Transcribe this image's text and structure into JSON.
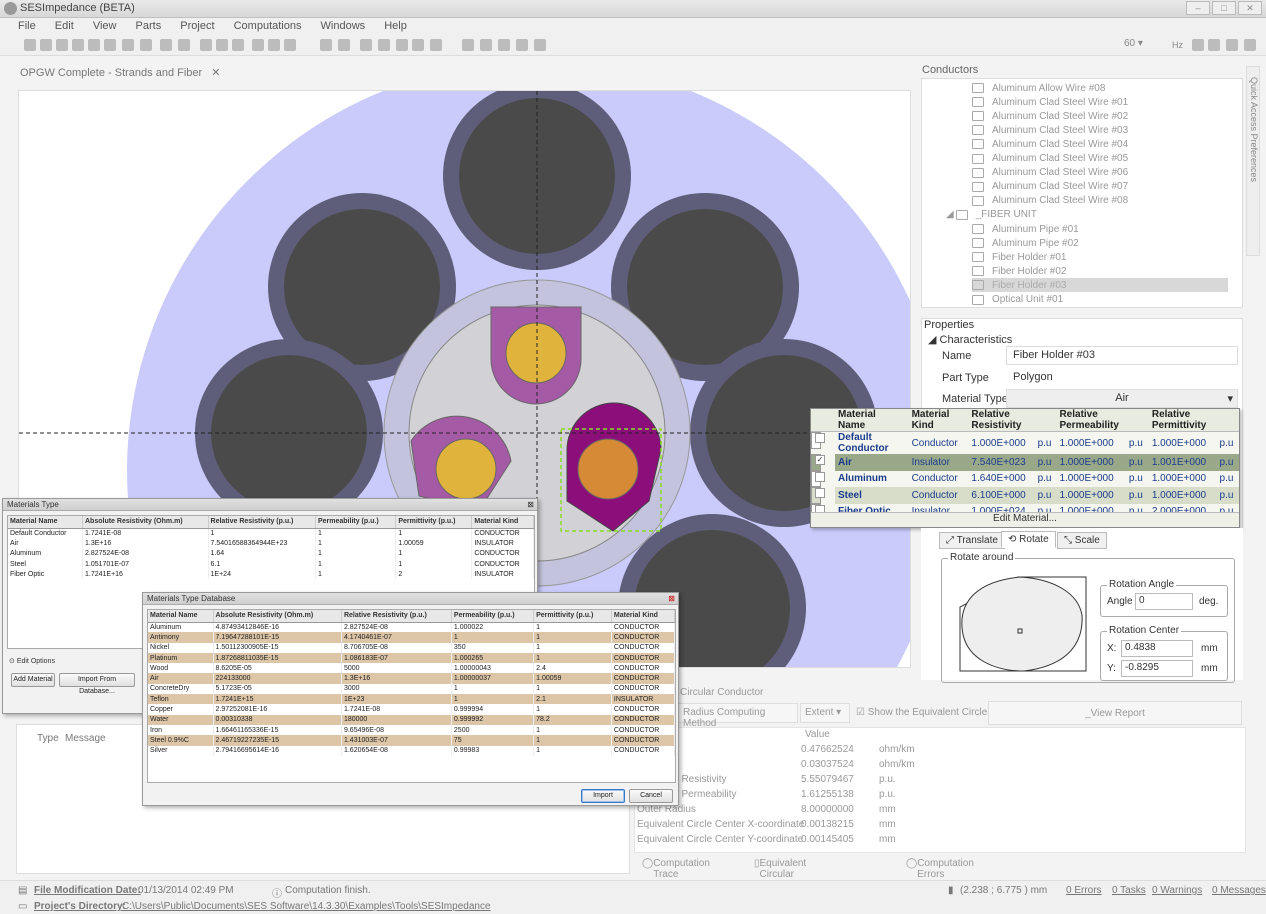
{
  "window": {
    "title": "SESImpedance (BETA)"
  },
  "menu": [
    "File",
    "Edit",
    "View",
    "Parts",
    "Project",
    "Computations",
    "Windows",
    "Help"
  ],
  "toolbar": {
    "frequency": "60",
    "frequency_unit": "Hz"
  },
  "document_tab": {
    "label": "OPGW Complete - Strands and Fiber"
  },
  "conductors_panel": {
    "title": "Conductors",
    "items": [
      {
        "label": "Aluminum Allow Wire #08",
        "level": 2
      },
      {
        "label": "Aluminum Clad Steel Wire #01",
        "level": 2
      },
      {
        "label": "Aluminum Clad Steel Wire #02",
        "level": 2
      },
      {
        "label": "Aluminum Clad Steel Wire #03",
        "level": 2
      },
      {
        "label": "Aluminum Clad Steel Wire #04",
        "level": 2
      },
      {
        "label": "Aluminum Clad Steel Wire #05",
        "level": 2
      },
      {
        "label": "Aluminum Clad Steel Wire #06",
        "level": 2
      },
      {
        "label": "Aluminum Clad Steel Wire #07",
        "level": 2
      },
      {
        "label": "Aluminum Clad Steel Wire #08",
        "level": 2
      },
      {
        "label": "_FIBER UNIT",
        "level": 1
      },
      {
        "label": "Aluminum Pipe #01",
        "level": 2
      },
      {
        "label": "Aluminum Pipe #02",
        "level": 2
      },
      {
        "label": "Fiber Holder #01",
        "level": 2
      },
      {
        "label": "Fiber Holder #02",
        "level": 2
      },
      {
        "label": "Fiber Holder #03",
        "level": 2,
        "selected": true
      },
      {
        "label": "Optical Unit #01",
        "level": 2
      }
    ]
  },
  "properties": {
    "title": "Properties",
    "section": "Characteristics",
    "name_label": "Name",
    "name_value": "Fiber Holder #03",
    "part_type_label": "Part Type",
    "part_type_value": "Polygon",
    "material_type_label": "Material Type",
    "material_type_value": "Air"
  },
  "material_dropdown": {
    "headers": [
      "Material Name",
      "Material Kind",
      "Relative Resistivity",
      "Relative Permeability",
      "Relative Permittivity"
    ],
    "rows": [
      {
        "checked": "",
        "name": "Default Conductor",
        "kind": "Conductor",
        "res": "1.000E+000",
        "res_u": "p.u",
        "perm": "1.000E+000",
        "perm_u": "p.u",
        "permit": "1.000E+000",
        "permit_u": "p.u"
      },
      {
        "checked": "✓",
        "name": "Air",
        "kind": "Insulator",
        "res": "7.540E+023",
        "res_u": "p.u",
        "perm": "1.000E+000",
        "perm_u": "p.u",
        "permit": "1.001E+000",
        "permit_u": "p.u"
      },
      {
        "checked": "",
        "name": "Aluminum",
        "kind": "Conductor",
        "res": "1.640E+000",
        "res_u": "p.u",
        "perm": "1.000E+000",
        "perm_u": "p.u",
        "permit": "1.000E+000",
        "permit_u": "p.u"
      },
      {
        "checked": "",
        "name": "Steel",
        "kind": "Conductor",
        "res": "6.100E+000",
        "res_u": "p.u",
        "perm": "1.000E+000",
        "perm_u": "p.u",
        "permit": "1.000E+000",
        "permit_u": "p.u"
      },
      {
        "checked": "",
        "name": "Fiber Optic",
        "kind": "Insulator",
        "res": "1.000E+024",
        "res_u": "p.u",
        "perm": "1.000E+000",
        "perm_u": "p.u",
        "permit": "2.000E+000",
        "permit_u": "p.u"
      }
    ],
    "edit_label": "Edit Material..."
  },
  "transform": {
    "tabs": [
      "Translate",
      "Rotate",
      "Scale"
    ],
    "rotate_around_label": "Rotate around",
    "rotation_angle_label": "Rotation Angle",
    "angle_label": "Angle",
    "angle_value": "0",
    "angle_unit": "deg.",
    "rotation_center_label": "Rotation Center",
    "x_label": "X:",
    "x_value": "0.4838",
    "x_unit": "mm",
    "y_label": "Y:",
    "y_value": "-0.8295",
    "y_unit": "mm"
  },
  "materials_type": {
    "title": "Materials Type",
    "headers": [
      "Material Name",
      "Absolute Resistivity (Ohm.m)",
      "Relative Resistivity (p.u.)",
      "Permeability (p.u.)",
      "Permittivity (p.u.)",
      "Material Kind"
    ],
    "rows": [
      [
        "Default Conductor",
        "1.7241E-08",
        "1",
        "1",
        "1",
        "CONDUCTOR"
      ],
      [
        "Air",
        "1.3E+16",
        "7.54016588364944E+23",
        "1",
        "1.00059",
        "INSULATOR"
      ],
      [
        "Aluminum",
        "2.827524E-08",
        "1.64",
        "1",
        "1",
        "CONDUCTOR"
      ],
      [
        "Steel",
        "1.051701E-07",
        "6.1",
        "1",
        "1",
        "CONDUCTOR"
      ],
      [
        "Fiber Optic",
        "1.7241E+16",
        "1E+24",
        "1",
        "2",
        "INSULATOR"
      ]
    ],
    "edit_options_label": "Edit Options",
    "add_material_label": "Add Material",
    "import_label": "Import From Database..."
  },
  "materials_db": {
    "title": "Materials Type Database",
    "headers": [
      "Material Name",
      "Absolute Resistivity (Ohm.m)",
      "Relative Resistivity (p.u.)",
      "Permeability (p.u.)",
      "Permittivity (p.u.)",
      "Material Kind"
    ],
    "rows": [
      [
        "Aluminum",
        "4.87493412846E-16",
        "2.827524E-08",
        "1.000022",
        "1",
        "CONDUCTOR"
      ],
      [
        "Antimony",
        "7.19647288101E-15",
        "4.1740461E-07",
        "1",
        "1",
        "CONDUCTOR"
      ],
      [
        "Nickel",
        "1.50112300905E-15",
        "8.706705E-08",
        "350",
        "1",
        "CONDUCTOR"
      ],
      [
        "Platinum",
        "1.87268811035E-15",
        "1.086183E-07",
        "1.000265",
        "1",
        "CONDUCTOR"
      ],
      [
        "Wood",
        "8.6205E-05",
        "5000",
        "1.00000043",
        "2.4",
        "CONDUCTOR"
      ],
      [
        "Air",
        "224133000",
        "1.3E+16",
        "1.00000037",
        "1.00059",
        "CONDUCTOR"
      ],
      [
        "ConcreteDry",
        "5.1723E-05",
        "3000",
        "1",
        "1",
        "CONDUCTOR"
      ],
      [
        "Teflon",
        "1.7241E+15",
        "1E+23",
        "1",
        "2.1",
        "INSULATOR"
      ],
      [
        "Copper",
        "2.97252081E-16",
        "1.7241E-08",
        "0.999994",
        "1",
        "CONDUCTOR"
      ],
      [
        "Water",
        "0.00310338",
        "180000",
        "0.999992",
        "78.2",
        "CONDUCTOR"
      ],
      [
        "Iron",
        "1.66461165336E-15",
        "9.65496E-08",
        "2500",
        "1",
        "CONDUCTOR"
      ],
      [
        "Steel 0.9%C",
        "2.46719227235E-15",
        "1.431003E-07",
        "75",
        "1",
        "CONDUCTOR"
      ],
      [
        "Silver",
        "2.79416695614E-16",
        "1.620654E-08",
        "0.99983",
        "1",
        "CONDUCTOR"
      ]
    ],
    "import_label": "Import",
    "cancel_label": "Cancel"
  },
  "messages": {
    "type_header": "Type",
    "message_header": "Message"
  },
  "equivalent_panel": {
    "title": "Circular Conductor",
    "method_label": "Radius Computing Method",
    "method_value": "Extent",
    "show_equiv_label": "Show the Equivalent Circle",
    "view_report_label": "_View Report",
    "value_header": "Value",
    "rows": [
      {
        "label": "e",
        "value": "0.47662524",
        "unit": "ohm/km"
      },
      {
        "label": "",
        "value": "0.03037524",
        "unit": "ohm/km"
      },
      {
        "label": "t Relative Resistivity",
        "value": "5.55079467",
        "unit": "p.u."
      },
      {
        "label": "t Relative Permeability",
        "value": "1.61255138",
        "unit": "p.u."
      },
      {
        "label": "Outer Radius",
        "value": "8.00000000",
        "unit": "mm"
      },
      {
        "label": "Equivalent Circle Center X-coordinate",
        "value": "0.00138215",
        "unit": "mm"
      },
      {
        "label": "Equivalent Circle Center Y-coordinate",
        "value": "0.00145405",
        "unit": "mm"
      }
    ],
    "tabs": [
      "Computation Trace",
      "Equivalent Circular Conductor",
      "Computation Errors"
    ]
  },
  "status": {
    "file_mod_label": "File Modification Date:",
    "file_mod_value": "01/13/2014 02:49 PM",
    "computation": "Computation finish.",
    "coords": "(2.238 ; 6.775 ) mm",
    "errors": "0 Errors",
    "tasks": "0 Tasks",
    "warnings": "0 Warnings",
    "messages": "0 Messages",
    "project_dir_label": "Project's Directory:",
    "project_dir_value": "C:\\Users\\Public\\Documents\\SES Software\\14.3.30\\Examples\\Tools\\SESImpedance"
  },
  "side_tab": "Quick Access Preferences",
  "colors": {
    "background_disc": "#cacbfa",
    "strand_ring": "#5e5e7a",
    "strand_core": "#4a4a4a",
    "fiber_holder": "#a55aa5",
    "fiber_core": "#e0b43c",
    "selected_holder": "#8b0e7a",
    "selected_core": "#d68a35"
  }
}
